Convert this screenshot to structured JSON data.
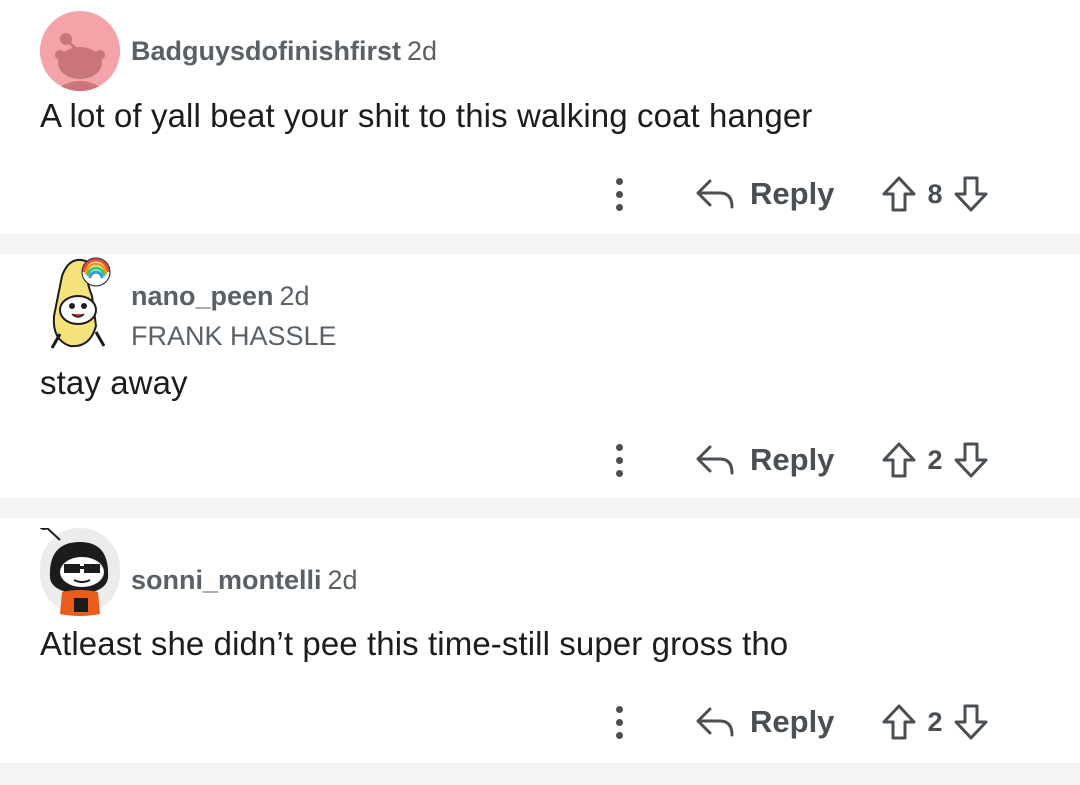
{
  "comments": [
    {
      "username": "Badguysdofinishfirst",
      "time": "2d",
      "flair": "",
      "body": "A lot of yall beat your shit to this walking coat hanger",
      "reply_label": "Reply",
      "votes": "8",
      "avatar_bg": "#f4a3a8"
    },
    {
      "username": "nano_peen",
      "time": "2d",
      "flair": "FRANK HASSLE",
      "body": "stay away",
      "reply_label": "Reply",
      "votes": "2",
      "avatar_bg": "#ffffff"
    },
    {
      "username": "sonni_montelli",
      "time": "2d",
      "flair": "",
      "body": "Atleast she didn’t pee this time-still super gross tho",
      "reply_label": "Reply",
      "votes": "2",
      "avatar_bg": "#ececec"
    }
  ],
  "colors": {
    "meta_text": "#5a6166",
    "action_icon": "#4a4f53",
    "divider": "#f3f4f5"
  },
  "icons": [
    "more-vertical-icon",
    "reply-arrow-icon",
    "upvote-icon",
    "downvote-icon"
  ]
}
